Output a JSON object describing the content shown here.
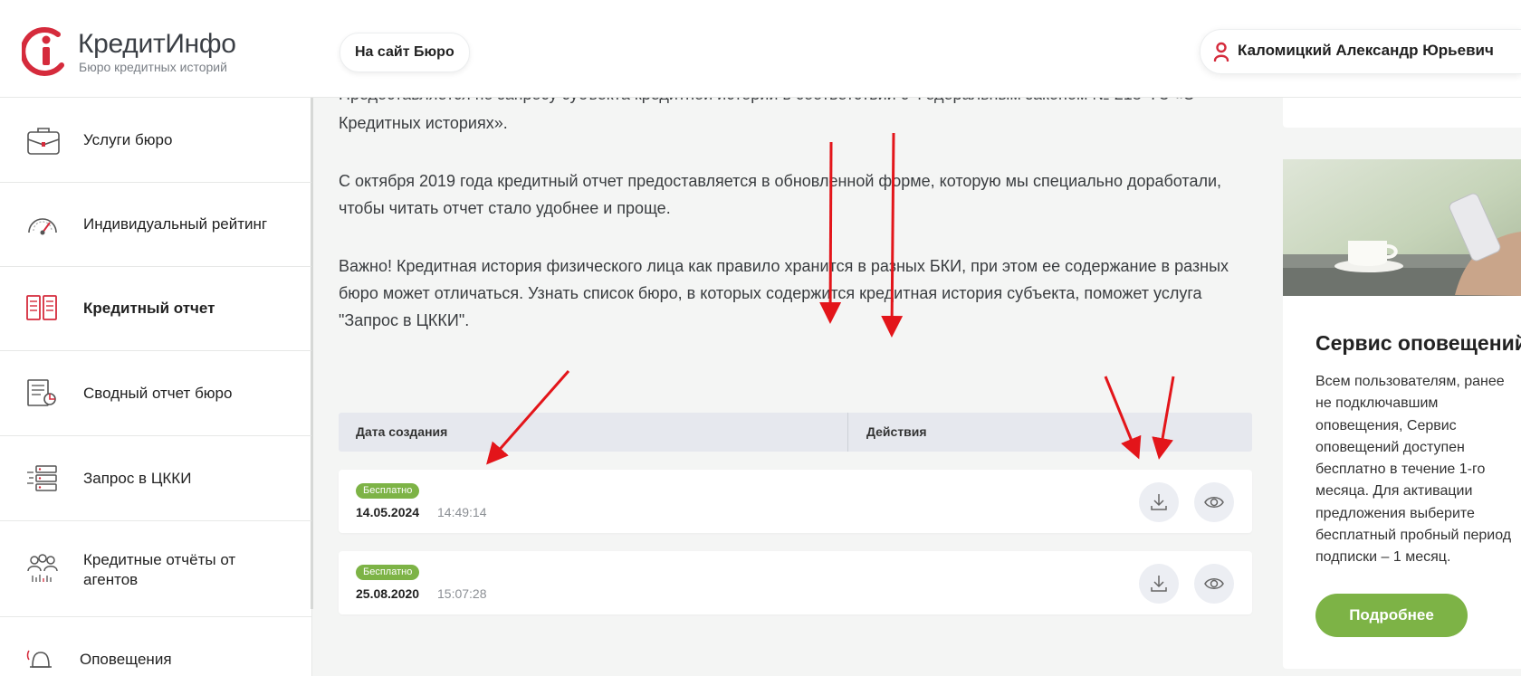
{
  "colors": {
    "accent_green": "#7db346",
    "brand_red": "#d52b3c",
    "annotation_red": "#e3151a"
  },
  "header": {
    "logo_title": "КредитИнфо",
    "logo_subtitle": "Бюро кредитных историй",
    "site_button": "На сайт Бюро",
    "user_name": "Каломицкий Александр Юрьевич",
    "user_icon": "user-icon"
  },
  "sidebar": {
    "items": [
      {
        "label": "Услуги бюро",
        "icon": "briefcase-icon"
      },
      {
        "label": "Индивидуальный рейтинг",
        "icon": "gauge-icon"
      },
      {
        "label": "Кредитный отчет",
        "icon": "report-icon",
        "active": true
      },
      {
        "label": "Сводный отчет бюро",
        "icon": "summary-report-icon"
      },
      {
        "label": "Запрос в ЦККИ",
        "icon": "servers-icon"
      },
      {
        "label": "Кредитные отчёты от агентов",
        "icon": "agents-icon"
      },
      {
        "label": "Оповещения",
        "icon": "bell-icon"
      }
    ]
  },
  "main": {
    "paragraphs": [
      "Предоставляется по запросу субъекта кредитной истории в соответствии с Федеральным законом № 218-ФЗ «О",
      "Кредитных историях».",
      "С октября 2019 года кредитный отчет предоставляется в обновленной форме, которую мы специально доработали,",
      "чтобы читать отчет стало удобнее и проще.",
      "Важно! Кредитная история физического лица как правило хранится в разных БКИ, при этом ее содержание в разных",
      "бюро может отличаться. Узнать список бюро, в которых содержится кредитная история субъекта, поможет услуга",
      "\"Запрос в ЦККИ\"."
    ],
    "table": {
      "columns": [
        "Дата создания",
        "Действия"
      ],
      "rows": [
        {
          "badge": "Бесплатно",
          "date": "14.05.2024",
          "time": "14:49:14"
        },
        {
          "badge": "Бесплатно",
          "date": "25.08.2020",
          "time": "15:07:28"
        }
      ],
      "actions": [
        "download-icon",
        "eye-icon"
      ]
    }
  },
  "promo": {
    "title": "Сервис оповещений",
    "text_lines": [
      "Всем пользователям, ранее",
      "не подключавшим",
      "оповещения, Сервис",
      "оповещений доступен",
      "бесплатно в течение 1-го",
      "месяца. Для активации",
      "предложения выберите",
      "бесплатный пробный период",
      "подписки – 1 месяц."
    ],
    "button": "Подробнее"
  }
}
